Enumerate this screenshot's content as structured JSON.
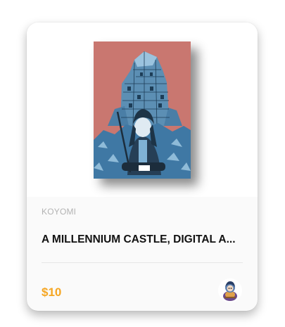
{
  "card": {
    "creator": "KOYOMI",
    "title": "A MILLENNIUM CASTLE, DIGITAL A...",
    "price": "$10",
    "artwork_icon": "castle-illustration",
    "avatar_icon": "creator-avatar"
  },
  "colors": {
    "price": "#f5a623",
    "artwork_background": "#c97770",
    "artwork_primary": "#4f86ad"
  }
}
